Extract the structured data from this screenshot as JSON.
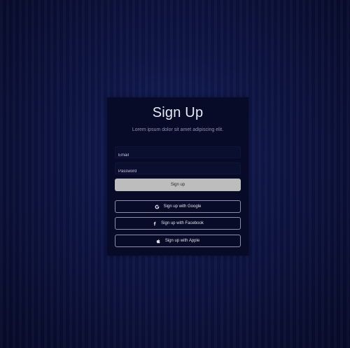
{
  "form": {
    "title": "Sign Up",
    "subtitle": "Lorem ipsum dolor sit amet adipiscing elit.",
    "email_placeholder": "Email",
    "password_placeholder": "Password",
    "submit_label": "Sign up"
  },
  "social": [
    {
      "label": "Sign up with Google",
      "icon": "google-icon"
    },
    {
      "label": "Sign up with Facebook",
      "icon": "facebook-icon"
    },
    {
      "label": "Sign up with Apple",
      "icon": "apple-icon"
    }
  ],
  "colors": {
    "background": "#0b1038",
    "card": "#070b27",
    "primary_button": "#bdbdbd",
    "outline": "#8b8fa8"
  }
}
